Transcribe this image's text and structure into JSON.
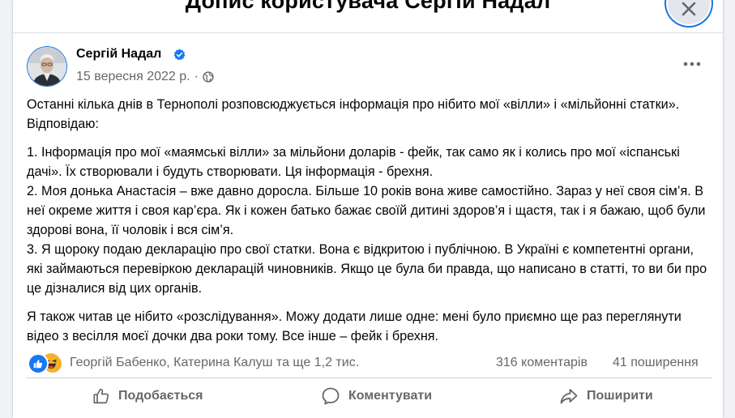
{
  "dialog": {
    "title": "Допис користувача Сергій Надал"
  },
  "post": {
    "author": "Сергій Надал",
    "date": "15 вересня 2022 р.",
    "separator": "·",
    "visibility_icon": "globe-icon",
    "paragraphs": [
      "Останні кілька днів в Тернополі розповсюджується інформація про нібито мої «вілли» і «мільйонні статки». Відповідаю:",
      "1. Інформація про мої «маямські вілли» за мільйони доларів - фейк, так само як і колись про мої «іспанські дачі». Їх створювали і будуть створювати. Ця інформація - брехня.\n2. Моя донька Анастасія – вже давно доросла. Більше 10 років вона живе самостійно. Зараз у неї своя сім’я. В неї окреме життя і своя кар’єра. Як і кожен батько бажає своїй дитині здоров’я і щастя, так і я бажаю, щоб були здорові вона, її чоловік і вся сім’я.\n3. Я щороку подаю декларацію про свої статки. Вона є відкритою і публічною. В Україні є компетентні органи, які займаються перевіркою декларацій чиновників. Якщо це була би правда, що написано в статті, то ви би про це дізналися від цих органів.",
      "Я також читав це нібито «розслідування». Можу додати лише одне: мені було приємно ще раз переглянути відео з весілля моєї дочки два роки тому. Все інше – фейк і брехня."
    ]
  },
  "stats": {
    "reactions_text": "Георгій Бабенко, Катерина Калуш та ще 1,2 тис.",
    "comments": "316 коментарів",
    "shares": "41 поширення"
  },
  "actions": {
    "like": "Подобається",
    "comment": "Коментувати",
    "share": "Поширити"
  },
  "colors": {
    "accent": "#1877f2",
    "secondary_text": "#65676b",
    "haha": "#f7b125"
  }
}
